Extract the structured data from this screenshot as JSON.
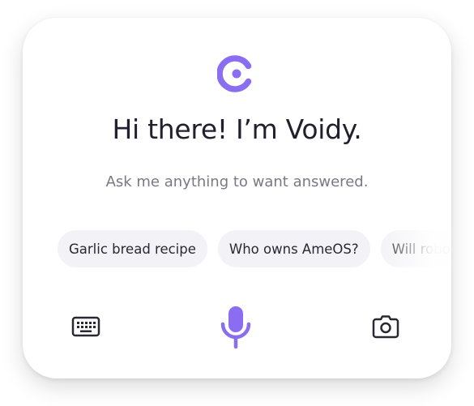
{
  "assistant": {
    "greeting": "Hi there! I’m Voidy.",
    "prompt": "Ask me anything to want answered."
  },
  "suggestions": [
    {
      "label": "Garlic bread recipe"
    },
    {
      "label": "Who owns AmeOS?"
    },
    {
      "label": "Will robots take over?"
    }
  ],
  "toolbar": {
    "left_icon": "keyboard-icon",
    "center_icon": "microphone-icon",
    "right_icon": "camera-icon"
  },
  "colors": {
    "accent": "#8a6df0",
    "text": "#22202e",
    "muted": "#7a7884",
    "chip_bg": "#f3f2f7"
  }
}
